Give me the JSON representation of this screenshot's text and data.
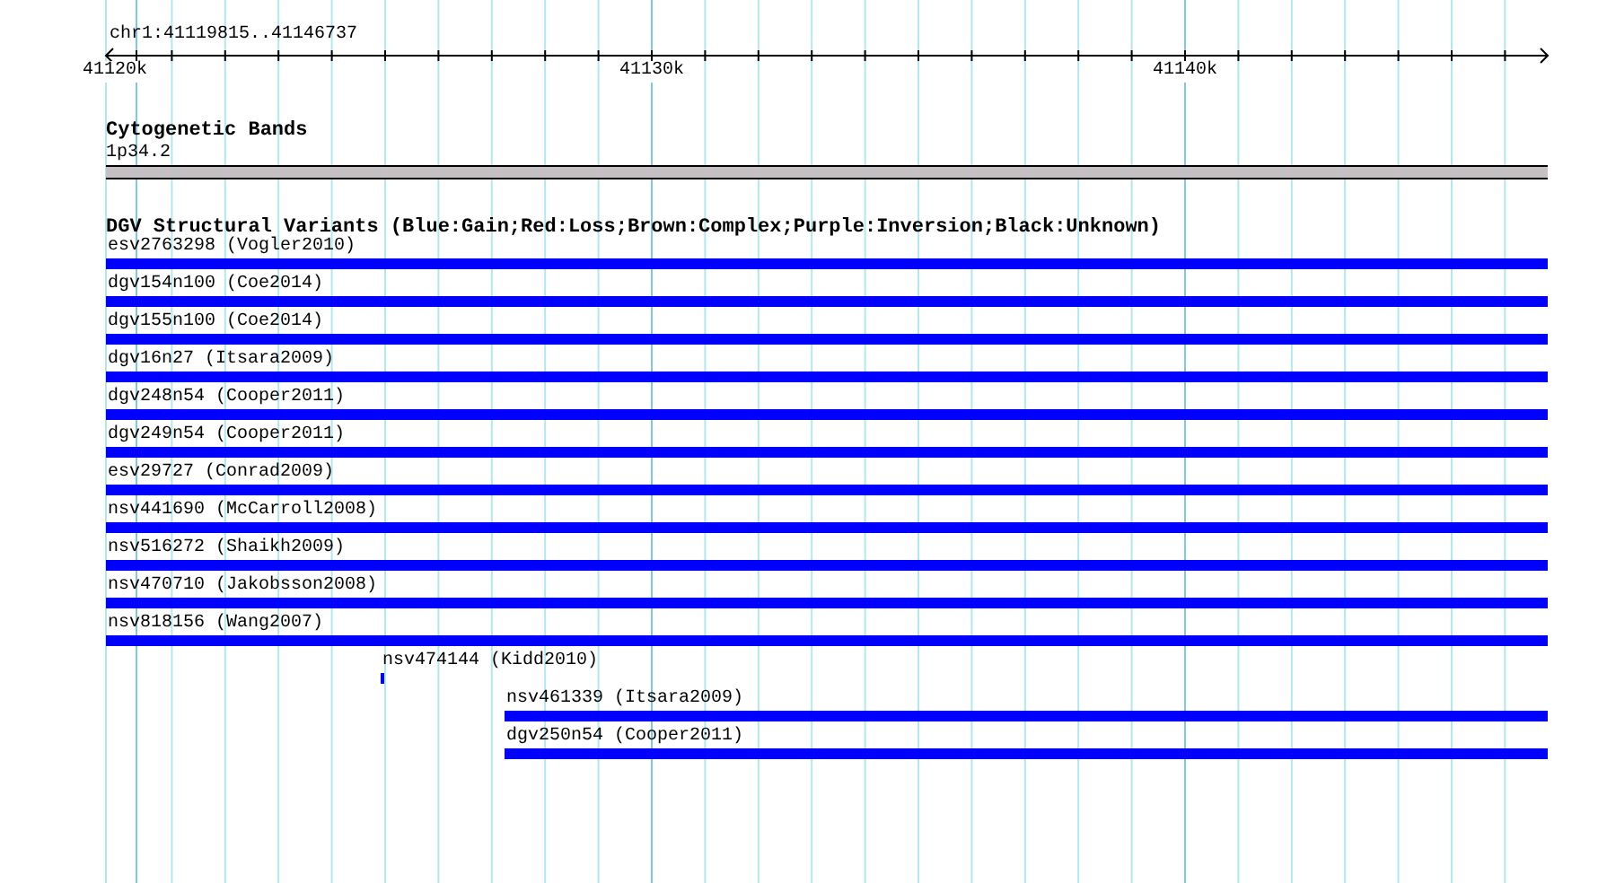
{
  "ruler": {
    "region": "chr1:41119815..41146737",
    "ticks": [
      {
        "label": "41120k"
      },
      {
        "label": "41130k"
      },
      {
        "label": "41140k"
      }
    ]
  },
  "cytogenetic_bands": {
    "title": "Cytogenetic Bands",
    "band": "1p34.2"
  },
  "structural_variants": {
    "title": "DGV Structural Variants (Blue:Gain;Red:Loss;Brown:Complex;Purple:Inversion;Black:Unknown)",
    "features": [
      {
        "label": "esv2763298 (Vogler2010)",
        "kind": "full",
        "color": "#0000ff"
      },
      {
        "label": "dgv154n100 (Coe2014)",
        "kind": "full",
        "color": "#0000ff"
      },
      {
        "label": "dgv155n100 (Coe2014)",
        "kind": "full",
        "color": "#0000ff"
      },
      {
        "label": "dgv16n27 (Itsara2009)",
        "kind": "full",
        "color": "#0000ff"
      },
      {
        "label": "dgv248n54 (Cooper2011)",
        "kind": "full",
        "color": "#0000ff"
      },
      {
        "label": "dgv249n54 (Cooper2011)",
        "kind": "full",
        "color": "#0000ff"
      },
      {
        "label": "esv29727 (Conrad2009)",
        "kind": "full",
        "color": "#0000ff"
      },
      {
        "label": "nsv441690 (McCarroll2008)",
        "kind": "full",
        "color": "#0000ff"
      },
      {
        "label": "nsv516272 (Shaikh2009)",
        "kind": "full",
        "color": "#0000ff"
      },
      {
        "label": "nsv470710 (Jakobsson2008)",
        "kind": "full",
        "color": "#0000ff"
      },
      {
        "label": "nsv818156 (Wang2007)",
        "kind": "full",
        "color": "#0000ff"
      },
      {
        "label": "nsv474144 (Kidd2010)",
        "kind": "point",
        "color": "#0000ff"
      },
      {
        "label": "nsv461339 (Itsara2009)",
        "kind": "partial",
        "color": "#0000ff"
      },
      {
        "label": "dgv250n54 (Cooper2011)",
        "kind": "partial",
        "color": "#0000ff"
      }
    ]
  }
}
